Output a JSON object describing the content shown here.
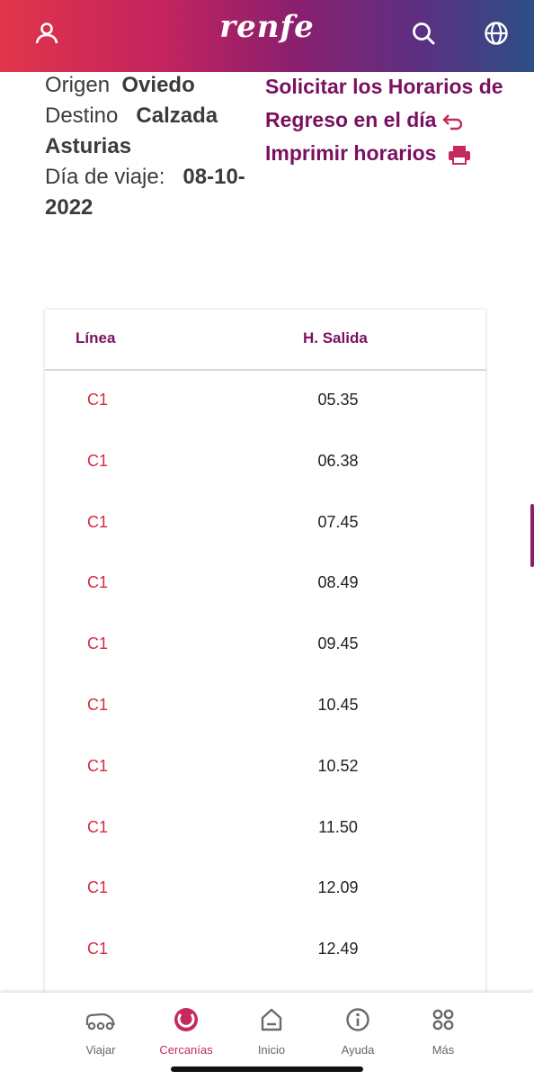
{
  "header": {
    "logo": "renfe",
    "icons": {
      "user": "user-icon",
      "search": "search-icon",
      "language": "globe-icon"
    }
  },
  "trip": {
    "origin_label": "Origen",
    "origin_value": "Oviedo",
    "destination_label": "Destino",
    "destination_value": "Calzada Asturias",
    "date_label": "Día de viaje:",
    "date_value": "08-10-2022"
  },
  "links": {
    "return_schedules": "Solicitar los Horarios de Regreso en el día",
    "print_schedules": "Imprimir horarios"
  },
  "table": {
    "headers": [
      "Línea",
      "H. Salida"
    ],
    "rows": [
      {
        "line": "C1",
        "departure": "05.35"
      },
      {
        "line": "C1",
        "departure": "06.38"
      },
      {
        "line": "C1",
        "departure": "07.45"
      },
      {
        "line": "C1",
        "departure": "08.49"
      },
      {
        "line": "C1",
        "departure": "09.45"
      },
      {
        "line": "C1",
        "departure": "10.45"
      },
      {
        "line": "C1",
        "departure": "10.52"
      },
      {
        "line": "C1",
        "departure": "11.50"
      },
      {
        "line": "C1",
        "departure": "12.09"
      },
      {
        "line": "C1",
        "departure": "12.49"
      }
    ]
  },
  "bottom_nav": {
    "items": [
      {
        "label": "Viajar",
        "icon": "car-icon"
      },
      {
        "label": "Cercanías",
        "icon": "cercanias-icon"
      },
      {
        "label": "Inicio",
        "icon": "home-icon"
      },
      {
        "label": "Ayuda",
        "icon": "info-icon"
      },
      {
        "label": "Más",
        "icon": "grid-icon"
      }
    ]
  },
  "colors": {
    "accent": "#7a1160",
    "line_red": "#d42a3e",
    "active_nav": "#c42a5c"
  }
}
